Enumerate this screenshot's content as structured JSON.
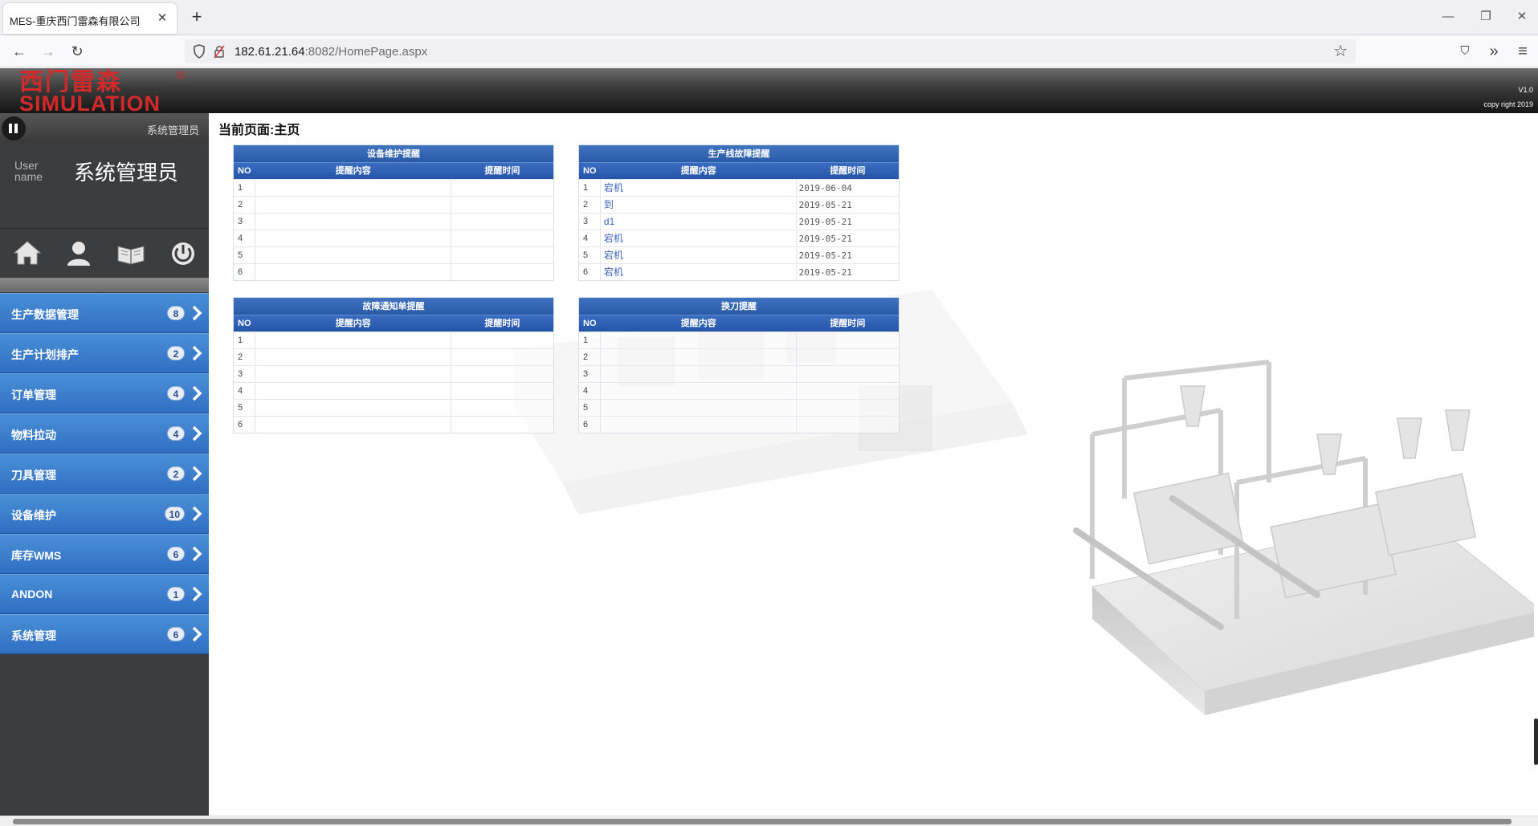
{
  "browser": {
    "tab_title": "MES-重庆西门雷森有限公司",
    "tab_close": "✕",
    "new_tab": "+",
    "url_host": "182.61.21.64",
    "url_path": ":8082/HomePage.aspx",
    "win_min": "—",
    "win_restore": "❐",
    "win_close": "✕",
    "back": "←",
    "forward": "→",
    "reload": "↻",
    "star": "☆",
    "pocket": "⛉",
    "more": "»",
    "menu": "≡"
  },
  "header": {
    "logo_cn": "西门雷森",
    "logo_en": "SIMULATION",
    "logo_reg": "®",
    "version": "V1.0",
    "copyright": "copy right 2019"
  },
  "sidebar": {
    "admin_small": "系统管理员",
    "user_label": "User name",
    "user_name": "系统管理员",
    "icons": [
      "home-icon",
      "user-icon",
      "book-icon",
      "power-icon"
    ],
    "menu": [
      {
        "label": "生产数据管理",
        "count": "8"
      },
      {
        "label": "生产计划排产",
        "count": "2"
      },
      {
        "label": "订单管理",
        "count": "4"
      },
      {
        "label": "物料拉动",
        "count": "4"
      },
      {
        "label": "刀具管理",
        "count": "2"
      },
      {
        "label": "设备维护",
        "count": "10"
      },
      {
        "label": "库存WMS",
        "count": "6"
      },
      {
        "label": "ANDON",
        "count": "1"
      },
      {
        "label": "系统管理",
        "count": "6"
      }
    ]
  },
  "main": {
    "breadcrumb": "当前页面:主页",
    "columns": {
      "no": "NO",
      "content": "提醒内容",
      "time": "提醒时间"
    },
    "panels": [
      {
        "title": "设备维护提醒",
        "rows": [
          {
            "no": "1",
            "content": "",
            "time": ""
          },
          {
            "no": "2",
            "content": "",
            "time": ""
          },
          {
            "no": "3",
            "content": "",
            "time": ""
          },
          {
            "no": "4",
            "content": "",
            "time": ""
          },
          {
            "no": "5",
            "content": "",
            "time": ""
          },
          {
            "no": "6",
            "content": "",
            "time": ""
          }
        ]
      },
      {
        "title": "生产线故障提醒",
        "rows": [
          {
            "no": "1",
            "content": "宕机",
            "time": "2019-06-04"
          },
          {
            "no": "2",
            "content": "到",
            "time": "2019-05-21"
          },
          {
            "no": "3",
            "content": "d1",
            "time": "2019-05-21"
          },
          {
            "no": "4",
            "content": "宕机",
            "time": "2019-05-21"
          },
          {
            "no": "5",
            "content": "宕机",
            "time": "2019-05-21"
          },
          {
            "no": "6",
            "content": "宕机",
            "time": "2019-05-21"
          }
        ]
      },
      {
        "title": "故障通知单提醒",
        "rows": [
          {
            "no": "1",
            "content": "",
            "time": ""
          },
          {
            "no": "2",
            "content": "",
            "time": ""
          },
          {
            "no": "3",
            "content": "",
            "time": ""
          },
          {
            "no": "4",
            "content": "",
            "time": ""
          },
          {
            "no": "5",
            "content": "",
            "time": ""
          },
          {
            "no": "6",
            "content": "",
            "time": ""
          }
        ]
      },
      {
        "title": "换刀提醒",
        "rows": [
          {
            "no": "1",
            "content": "",
            "time": ""
          },
          {
            "no": "2",
            "content": "",
            "time": ""
          },
          {
            "no": "3",
            "content": "",
            "time": ""
          },
          {
            "no": "4",
            "content": "",
            "time": ""
          },
          {
            "no": "5",
            "content": "",
            "time": ""
          },
          {
            "no": "6",
            "content": "",
            "time": ""
          }
        ]
      }
    ]
  }
}
